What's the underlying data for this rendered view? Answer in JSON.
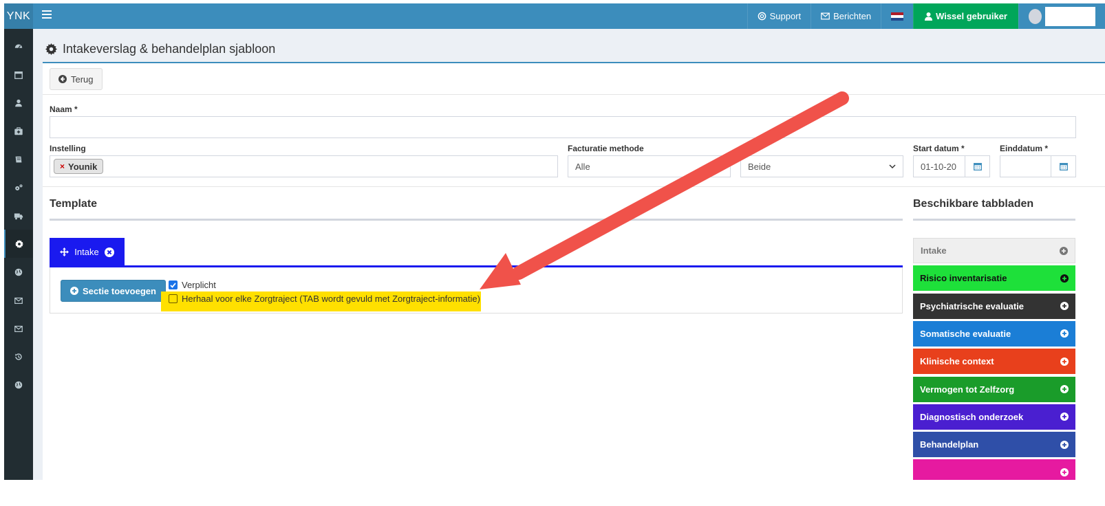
{
  "brand": {
    "logo_text": "YNK"
  },
  "topbar": {
    "support_label": "Support",
    "messages_label": "Berichten",
    "switch_user_label": "Wissel gebruiker",
    "flag_colors": [
      "#ae1c28",
      "#ffffff",
      "#21468b"
    ]
  },
  "sidebar": {
    "items": [
      {
        "icon": "dashboard-icon"
      },
      {
        "icon": "calendar-icon"
      },
      {
        "icon": "user-icon"
      },
      {
        "icon": "medkit-icon"
      },
      {
        "icon": "book-icon"
      },
      {
        "icon": "cogs-icon"
      },
      {
        "icon": "truck-icon"
      },
      {
        "icon": "gear-icon",
        "active": true
      },
      {
        "icon": "globe-icon"
      },
      {
        "icon": "envelope-icon"
      },
      {
        "icon": "envelope-icon"
      },
      {
        "icon": "history-icon"
      },
      {
        "icon": "globe-icon"
      }
    ]
  },
  "page": {
    "title": "Intakeverslag & behandelplan sjabloon"
  },
  "form": {
    "back_label": "Terug",
    "naam_label": "Naam *",
    "naam_value": "",
    "instelling_label": "Instelling",
    "instelling_tag": "Younik",
    "facturatie_label": "Facturatie methode",
    "facturatie_value": "Alle",
    "type_value": "Beide",
    "start_label": "Start datum *",
    "start_value": "01-10-20",
    "eind_label": "Einddatum *",
    "eind_value": ""
  },
  "template": {
    "heading": "Template",
    "tab_label": "Intake",
    "add_section_label": "Sectie toevoegen",
    "verplicht_label": "Verplicht",
    "verplicht_checked": true,
    "herhaal_label": "Herhaal voor elke Zorgtraject (TAB wordt gevuld met Zorgtraject-informatie)",
    "herhaal_checked": false
  },
  "available_tabs": {
    "heading": "Beschikbare tabbladen",
    "items": [
      {
        "label": "Intake",
        "color": "#efefef",
        "text_color": "#777"
      },
      {
        "label": "Risico inventarisatie",
        "color": "#1ee03a",
        "text_color": "#111"
      },
      {
        "label": "Psychiatrische evaluatie",
        "color": "#333333",
        "text_color": "#fff"
      },
      {
        "label": "Somatische evaluatie",
        "color": "#1b7ed6",
        "text_color": "#fff"
      },
      {
        "label": "Klinische context",
        "color": "#e8401c",
        "text_color": "#fff"
      },
      {
        "label": "Vermogen tot Zelfzorg",
        "color": "#1a9c2a",
        "text_color": "#fff"
      },
      {
        "label": "Diagnostisch onderzoek",
        "color": "#4a1fd0",
        "text_color": "#fff"
      },
      {
        "label": "Behandelplan",
        "color": "#2f4fa8",
        "text_color": "#fff"
      },
      {
        "label": "",
        "color": "#e61aa0",
        "text_color": "#fff"
      }
    ]
  },
  "annotation": {
    "arrow_color": "#f0524a"
  }
}
